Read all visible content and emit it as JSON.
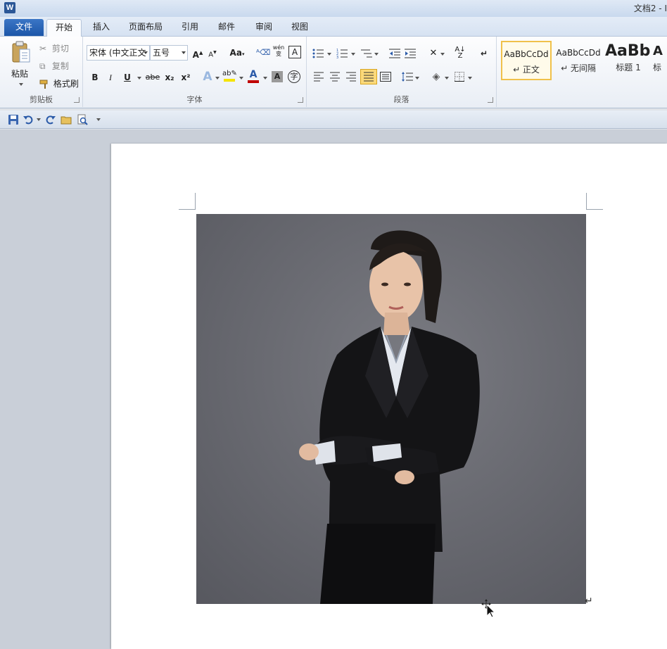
{
  "window": {
    "app_letter": "W",
    "doc_title": "文档2 - I"
  },
  "tabs": [
    {
      "label": "文件"
    },
    {
      "label": "开始"
    },
    {
      "label": "插入"
    },
    {
      "label": "页面布局"
    },
    {
      "label": "引用"
    },
    {
      "label": "邮件"
    },
    {
      "label": "审阅"
    },
    {
      "label": "视图"
    }
  ],
  "clipboard": {
    "paste_label": "粘贴",
    "cut_label": "剪切",
    "copy_label": "复制",
    "format_painter_label": "格式刷",
    "group_label": "剪贴板"
  },
  "font": {
    "font_name": "宋体 (中文正文",
    "font_size": "五号",
    "grow_label": "A",
    "shrink_label": "A",
    "case_label": "Aa",
    "bold": "B",
    "italic": "I",
    "underline": "U",
    "strike": "abe",
    "subscript": "x₂",
    "superscript": "x²",
    "phonetic": "wén",
    "group_label": "字体",
    "highlight_color": "#f5e400",
    "font_color": "#c00000"
  },
  "paragraph": {
    "group_label": "段落"
  },
  "styles": [
    {
      "sample": "AaBbCcDd",
      "name": "↵ 正文",
      "selected": true
    },
    {
      "sample": "AaBbCcDd",
      "name": "↵ 无间隔",
      "selected": false
    },
    {
      "sample": "AaBb",
      "name": "标题 1",
      "selected": false
    },
    {
      "sample": "A",
      "name": "标",
      "selected": false
    }
  ],
  "document": {
    "paragraph_mark": "↵"
  },
  "colors": {
    "file_tab": "#1c56a8",
    "selected_style_border": "#f0c14b"
  }
}
